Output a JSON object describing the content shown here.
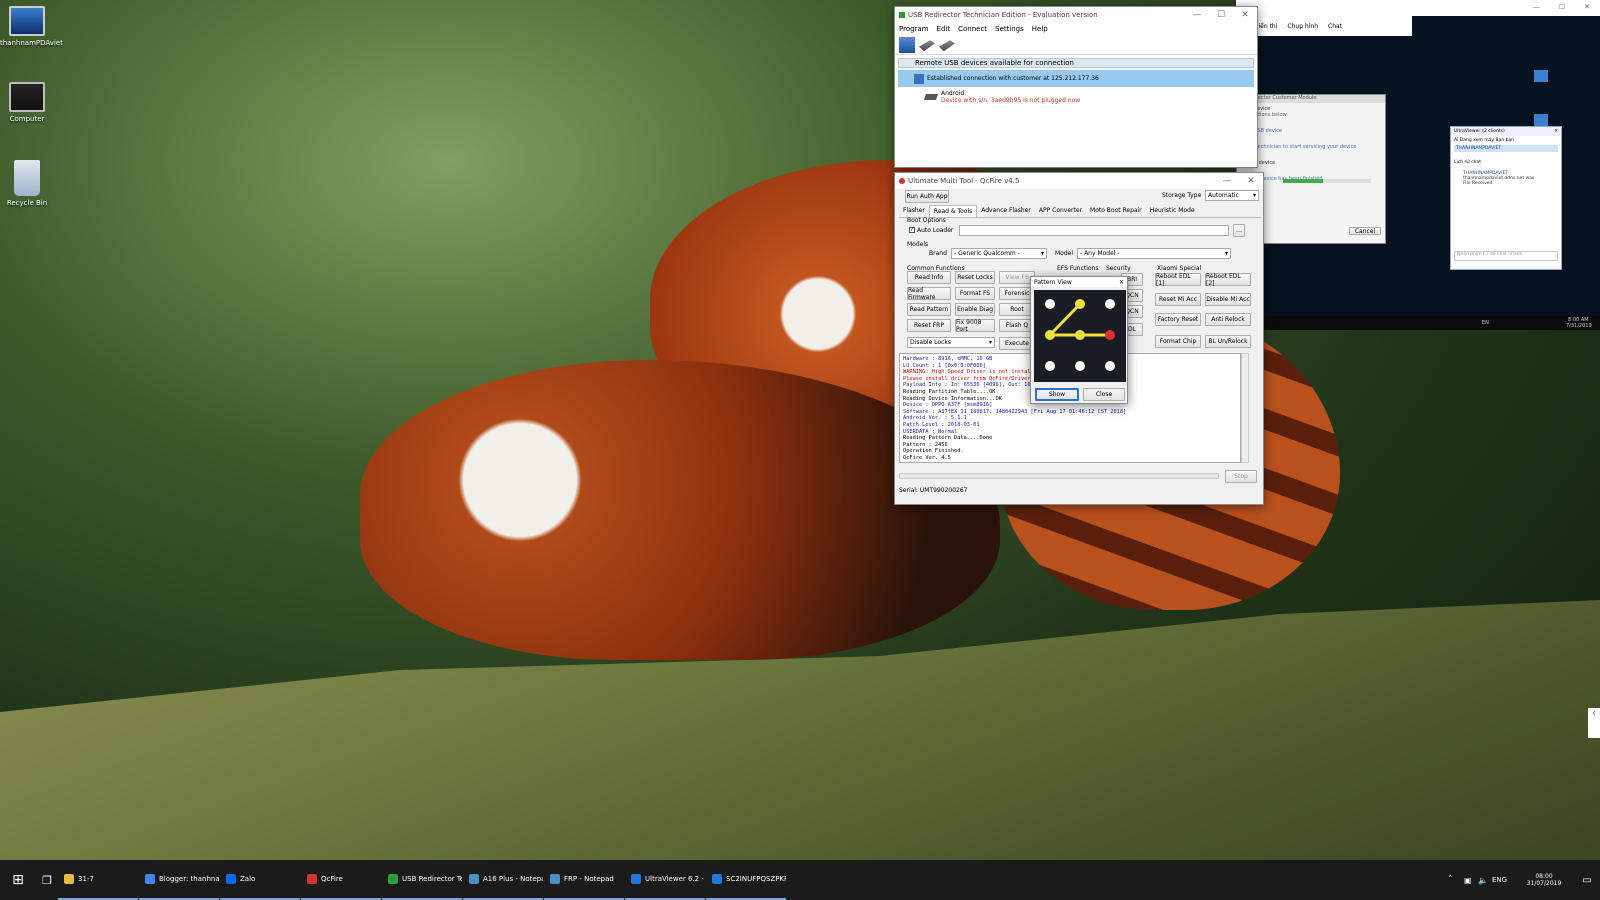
{
  "desktop": {
    "icons": [
      {
        "label": "thanhnamPDAviet"
      },
      {
        "label": "Computer"
      },
      {
        "label": "Recycle Bin"
      }
    ]
  },
  "usb": {
    "title": "USB Redirector Technician Edition - Evaluation version",
    "menu": [
      "Program",
      "Edit",
      "Connect",
      "Settings",
      "Help"
    ],
    "tab": "Remote USB devices available for connection",
    "row_connection": "Established connection with customer at 125.212.177.36",
    "device_name": "Android",
    "device_status": "Device with s/n: 3aed9b95 is not plugged now"
  },
  "remote": {
    "toolbar": [
      "Hiển thị",
      "Chụp hình",
      "Chat"
    ],
    "win_title": "Redirector Customer Module",
    "heading": "Your Device",
    "sub": "instructions below",
    "lines": [
      "your USB device",
      "g the technician to start servicing your device",
      "g your device",
      "of your device has been finished"
    ],
    "cancel": "Cancel",
    "clock_time": "8:00 AM",
    "clock_date": "7/31/2019",
    "tray_lang": "EN"
  },
  "ultra": {
    "title": "UltraViewer",
    "sub": "(2 clients)",
    "connecting": "Ai Đang xem máy Bạn bạn",
    "client": "THANHNAMPDAVIET",
    "chat_label": "Lịch sử chat",
    "chat_user": "THANHNAMPDAVIET",
    "chat_msg1": "thanhnampdaviet.ddns.net was",
    "chat_msg2": "File Received",
    "input_placeholder": "Nhấn phím F1 để chat nhanh"
  },
  "qcfire": {
    "title": "Ultimate Multi Tool - QcFire v4.5",
    "run_auth": "Run Auth App",
    "storage_label": "Storage Type",
    "storage": "Automatic",
    "tabs": [
      "Flasher",
      "Read & Tools",
      "Advance Flasher",
      "APP Converter",
      "Moto Boot Repair",
      "Heuristic Mode"
    ],
    "boot_options": "Boot Options",
    "auto_loader": "Auto Loader",
    "models": "Models",
    "brand_label": "Brand",
    "brand": "- Generic Qualcomm -",
    "model_label": "Model",
    "model": "- Any Model -",
    "common": "Common Functions",
    "efs": "EFS Functions",
    "security": "Security",
    "xiaomi": "Xiaomi Special",
    "col1": [
      "Read Info",
      "Read Firmware",
      "Read Pattern",
      "Reset FRP"
    ],
    "col2": [
      "Reset Locks",
      "Format FS",
      "Enable Diag",
      "Fix 9008 Port"
    ],
    "col3": [
      "View FS",
      "Forensic",
      "Root",
      "Flash Q",
      "Execute"
    ],
    "col4": [
      "BRI",
      "QCN",
      "QCN",
      "DL"
    ],
    "disable_locks": "Disable Locks",
    "xiaomi_btns": [
      "Reboot EDL [1]",
      "Reboot EDL [2]",
      "Reset Mi Acc",
      "Disable Mi Acc",
      "Factory Reset",
      "Anti Relock",
      "Format Chip",
      "BL Un/Relock"
    ],
    "log": [
      {
        "t": "Hardware     : 8916, eMMC, 16 GB",
        "c": "#1a1aa8"
      },
      {
        "t": "LU Count     : 1 [0x0:0:0F000]",
        "c": "#1a1aa8"
      },
      {
        "t": "WARNING: High Speed Driver is not installed.",
        "c": "#d00000"
      },
      {
        "t": "Please install driver from QcFire/Drivers folder using",
        "c": "#d00000"
      },
      {
        "t": "Payload Info : In: 65536 [4096], Out: 16384, Sec",
        "c": "#1a1aa8"
      },
      {
        "t": "Reading Partition Table....OK",
        "c": "#000"
      },
      {
        "t": "Reading Device Information...OK",
        "c": "#000"
      },
      {
        "t": "Device       : OPPO A37F [msm8916]",
        "c": "#1a1aa8"
      },
      {
        "t": "Software     : A37fEX_11_180817, 1480422943 [Fri Aug 17 01:46:12 CST 2018]",
        "c": "#1a1aa8"
      },
      {
        "t": "Android Ver. : 5.1.1",
        "c": "#1a1aa8"
      },
      {
        "t": "Patch Level  : 2018-03-01",
        "c": "#1a1aa8"
      },
      {
        "t": "USERDATA     : Normal",
        "c": "#1a1aa8"
      },
      {
        "t": "Reading Pattern Data....Done",
        "c": "#000"
      },
      {
        "t": "Pattern      : 2456",
        "c": "#000"
      },
      {
        "t": "Operation Finished.",
        "c": "#000"
      },
      {
        "t": "QcFire Ver. 4.5",
        "c": "#000"
      }
    ],
    "stop": "Stop",
    "serial": "Serial: UMT990200267"
  },
  "pattern": {
    "title": "Pattern View",
    "show": "Show",
    "close": "Close",
    "sequence": [
      2,
      4,
      5,
      6
    ]
  },
  "taskbar": {
    "items": [
      {
        "label": "31-7",
        "color": "#e8b93b"
      },
      {
        "label": "Blogger: thanhnam...",
        "color": "#4285f4"
      },
      {
        "label": "Zalo",
        "color": "#0068ff"
      },
      {
        "label": "QcFire",
        "color": "#d0342c"
      },
      {
        "label": "USB Redirector Tec...",
        "color": "#2a9d3a"
      },
      {
        "label": "A16 Plus - Notepad",
        "color": "#4a90c0"
      },
      {
        "label": "FRP - Notepad",
        "color": "#4a90c0"
      },
      {
        "label": "UltraViewer 6.2 - Fr...",
        "color": "#1e78d7"
      },
      {
        "label": "SC2INUFPQSZPKFC...",
        "color": "#1e78d7"
      }
    ],
    "lang": "ENG",
    "time": "08:00",
    "date": "31/07/2019"
  }
}
